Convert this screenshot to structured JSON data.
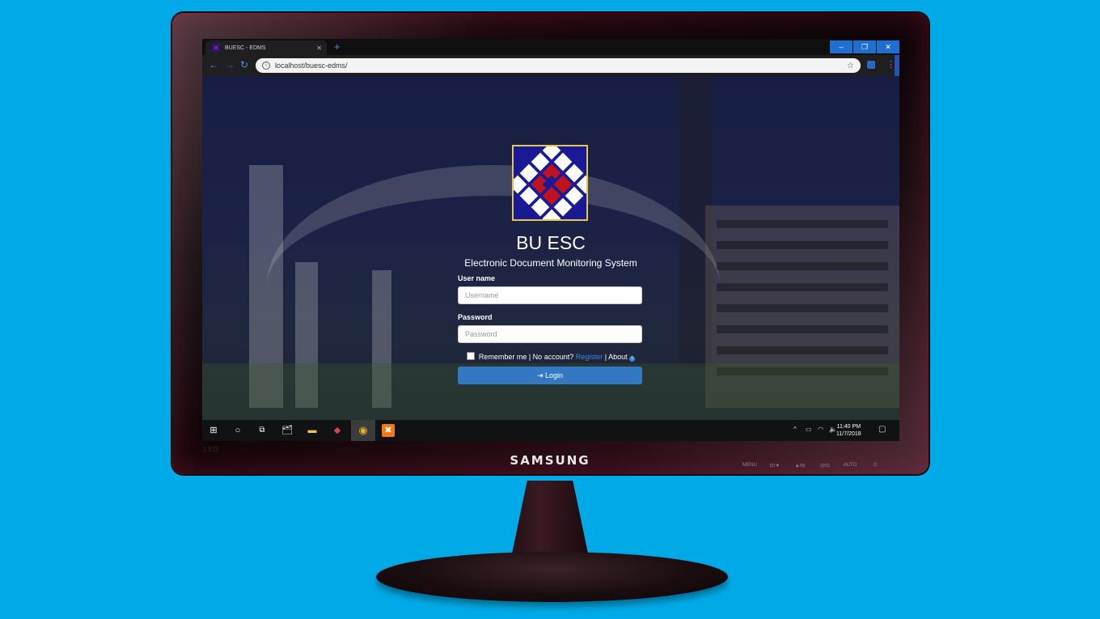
{
  "monitor": {
    "brand": "SAMSUNG",
    "buttons": [
      "MENU",
      "⊡/▼",
      "▲/⊟",
      "⊡/⊡",
      "AUTO",
      "⏻"
    ]
  },
  "browser": {
    "tab_title": "BUESC - EDMS",
    "tab_close": "✕",
    "new_tab": "+",
    "url": "localhost/buesc-edms/",
    "window_controls": {
      "minimize": "–",
      "maximize": "❐",
      "close": "✕"
    }
  },
  "login": {
    "title": "BU ESC",
    "subtitle": "Electronic Document Monitoring System",
    "username_label": "User name",
    "username_placeholder": "Username",
    "password_label": "Password",
    "password_placeholder": "Password",
    "remember_text": "Remember me | No account?",
    "register_link": "Register",
    "separator": "|",
    "about_link": "About",
    "login_button": "Login"
  },
  "taskbar": {
    "time": "11:40 PM",
    "date": "11/7/2018"
  },
  "colors": {
    "desktop_background": "#00aae6",
    "accent": "#3378c2",
    "logo_blue": "#1a1a96",
    "logo_red": "#c0121c"
  },
  "icons": [
    "windows-start-icon",
    "cortana-icon",
    "task-view-icon",
    "chrome-icon",
    "xampp-icon",
    "file-explorer-icon"
  ]
}
